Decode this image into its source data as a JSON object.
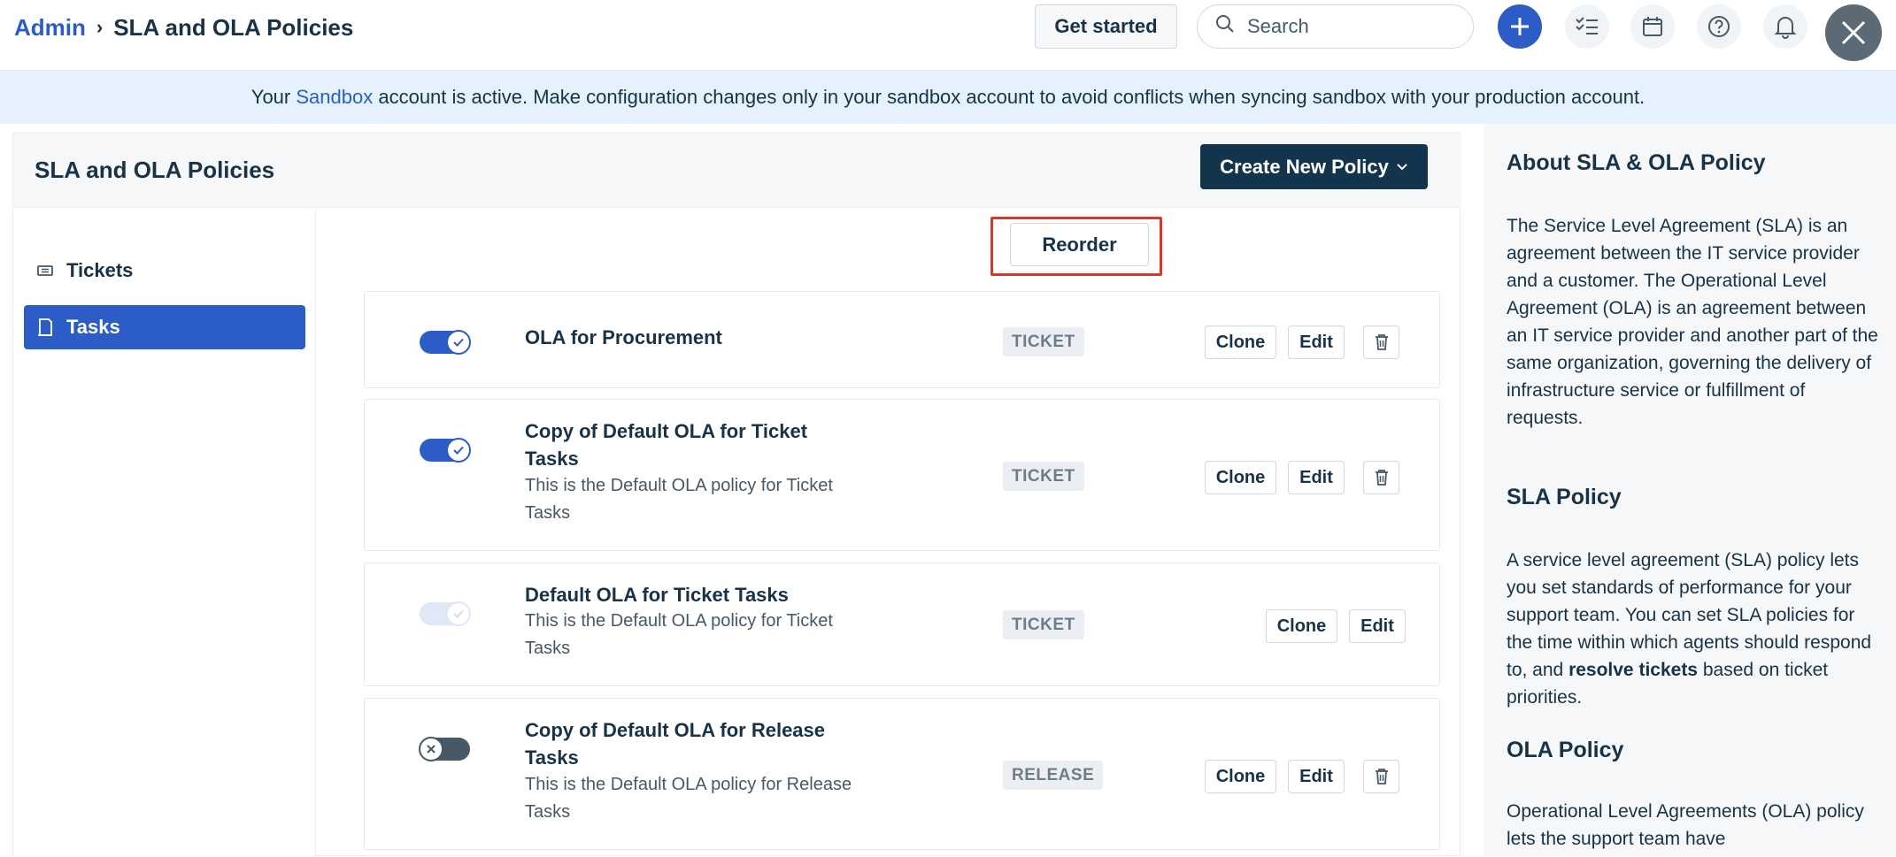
{
  "header": {
    "breadcrumb_root": "Admin",
    "breadcrumb_sep": "›",
    "breadcrumb_current": "SLA and OLA Policies",
    "get_started_label": "Get started",
    "search_placeholder": "Search"
  },
  "banner": {
    "prefix": "Your ",
    "link": "Sandbox",
    "suffix": " account is active. Make configuration changes only in your sandbox account to avoid conflicts when syncing sandbox with your production account."
  },
  "panel": {
    "title": "SLA and OLA Policies",
    "create_label": "Create New Policy",
    "reorder_label": "Reorder"
  },
  "sidebar": {
    "items": [
      {
        "label": "Tickets",
        "icon": "ticket-icon"
      },
      {
        "label": "Tasks",
        "icon": "task-icon",
        "active": true
      }
    ]
  },
  "policies": [
    {
      "title": "OLA for Procurement",
      "desc": "",
      "type": "TICKET",
      "state": "on",
      "clone": "Clone",
      "edit": "Edit"
    },
    {
      "title": "Copy of Default OLA for Ticket Tasks",
      "desc": "This is the Default OLA policy for Ticket Tasks",
      "type": "TICKET",
      "state": "on",
      "clone": "Clone",
      "edit": "Edit"
    },
    {
      "title": "Default OLA for Ticket Tasks",
      "desc": "This is the Default OLA policy for Ticket Tasks",
      "type": "TICKET",
      "state": "disabled",
      "clone": "Clone",
      "edit": "Edit"
    },
    {
      "title": "Copy of Default OLA for Release Tasks",
      "desc": "This is the Default OLA policy for Release Tasks",
      "type": "RELEASE",
      "state": "off",
      "clone": "Clone",
      "edit": "Edit"
    }
  ],
  "info": {
    "heading1": "About SLA & OLA Policy",
    "para1": "The Service Level Agreement (SLA) is an agreement between the IT service provider and a customer. The Operational Level Agreement (OLA) is an agreement between an IT service provider and another part of the same organization, governing the delivery of infrastructure service or fulfillment of requests.",
    "heading2": "SLA Policy",
    "para2_a": "A service level agreement (SLA) policy lets you set standards of performance for your support team. You can set SLA policies for the time within which agents should respond to, and ",
    "para2_bold": "resolve tickets",
    "para2_b": " based on ticket priorities.",
    "heading3": "OLA Policy",
    "para3": "Operational Level Agreements (OLA) policy lets the support team have"
  },
  "colors": {
    "primary": "#2c5cc5",
    "dark_button": "#12344d",
    "highlight": "#d9372b",
    "banner_bg": "#e5f2fd"
  }
}
